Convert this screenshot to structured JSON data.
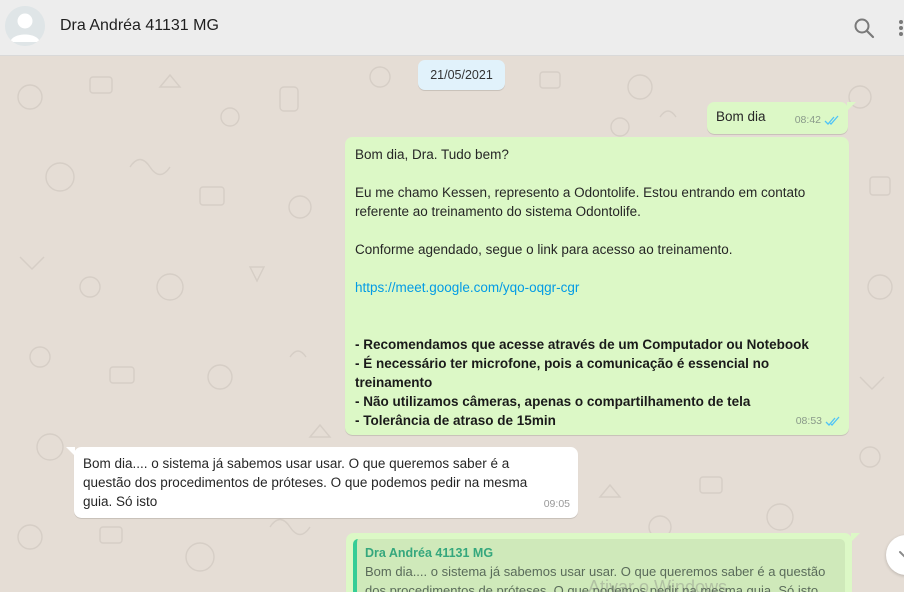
{
  "header": {
    "contact_name": "Dra Andréa 41131 MG",
    "icons": {
      "search": "search-icon",
      "menu": "menu-icon",
      "avatar": "avatar-icon"
    }
  },
  "chat": {
    "date_chip": "21/05/2021",
    "messages": [
      {
        "direction": "out",
        "text": "Bom dia",
        "time": "08:42",
        "status": "read"
      },
      {
        "direction": "out",
        "lines": {
          "greeting": "Bom dia, Dra. Tudo bem?",
          "intro_1": "Eu me chamo Kessen, represento a Odontolife. Estou entrando em contato",
          "intro_2": "referente ao treinamento do sistema Odontolife.",
          "schedule": "Conforme agendado, segue o link para acesso ao treinamento.",
          "link": "https://meet.google.com/yqo-oqgr-cgr",
          "rec_1": "- Recomendamos que acesse através de um Computador ou Notebook",
          "rec_2a": "- É necessário ter microfone, pois a comunicação é essencial no",
          "rec_2b": "treinamento",
          "rec_3": "- Não utilizamos câmeras, apenas o compartilhamento de tela",
          "rec_4": "- Tolerância de atraso de 15min"
        },
        "time": "08:53",
        "status": "read"
      },
      {
        "direction": "in",
        "lines": {
          "l1": "Bom dia.... o sistema já sabemos usar usar. O que queremos saber é  a",
          "l2": "questão dos procedimentos de próteses. O que podemos pedir na mesma",
          "l3": "guia. Só isto"
        },
        "time": "09:05"
      },
      {
        "direction": "out",
        "quoted": {
          "author": "Dra Andréa 41131 MG",
          "l1": "Bom dia.... o sistema já sabemos usar usar. O que queremos saber é  a questão",
          "l2": "dos procedimentos de próteses. O que podemos pedir na mesma guia. Só isto"
        }
      }
    ]
  },
  "watermark": "Ativar o Windows",
  "colors": {
    "out_bubble": "#dcf8c6",
    "in_bubble": "#ffffff",
    "link": "#039be5",
    "ticks": "#4fc3f7",
    "quote_accent": "#35cd96"
  }
}
